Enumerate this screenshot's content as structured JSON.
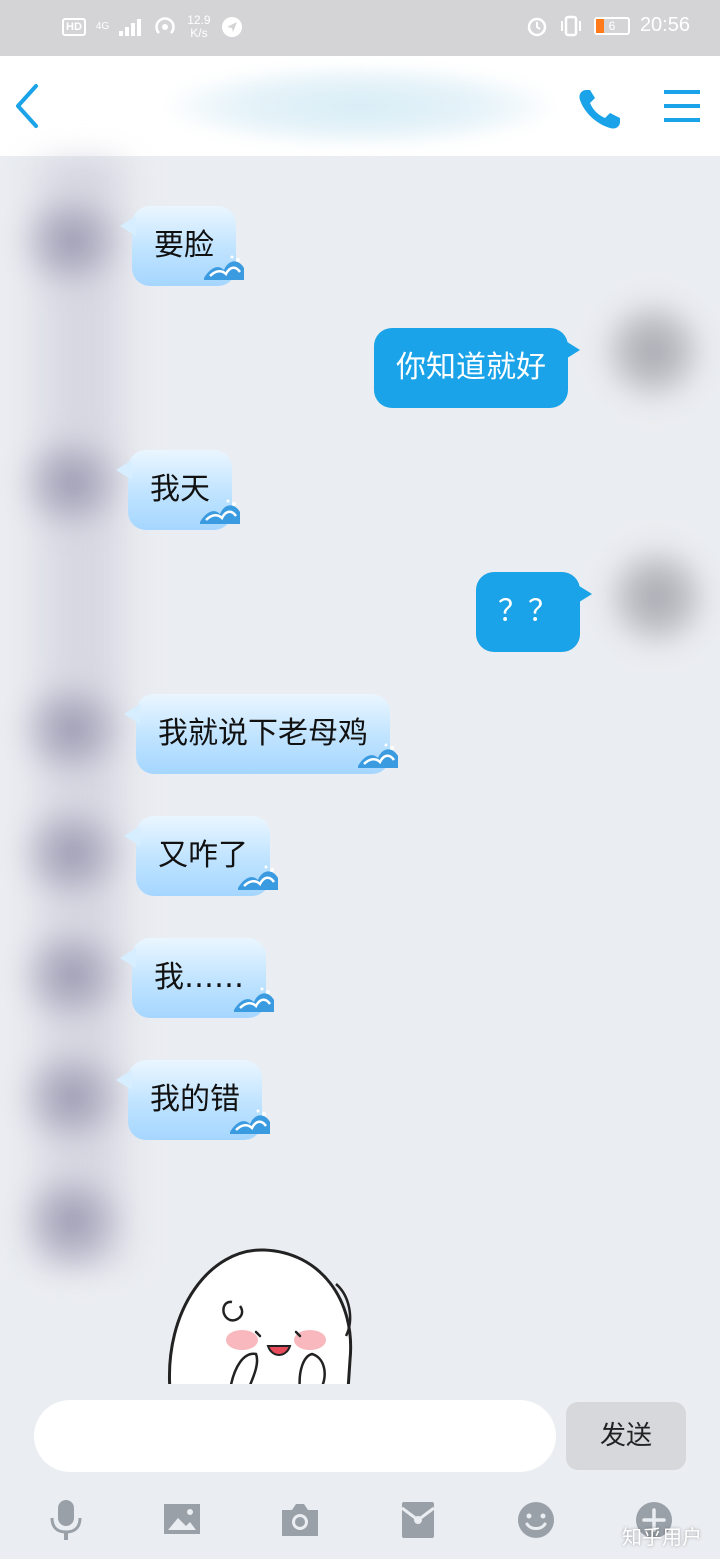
{
  "status_bar": {
    "hd": "HD",
    "network": "4G",
    "speed_value": "12.9",
    "speed_unit": "K/s",
    "battery": "6",
    "time": "20:56"
  },
  "header": {
    "back_icon": "chevron-left-icon",
    "call_icon": "phone-icon",
    "menu_icon": "hamburger-menu-icon",
    "accent_color": "#1aa3e8"
  },
  "messages": [
    {
      "side": "left",
      "text": "要脸"
    },
    {
      "side": "right",
      "text": "你知道就好"
    },
    {
      "side": "left",
      "text": "我天"
    },
    {
      "side": "right",
      "text": "？？"
    },
    {
      "side": "left",
      "text": "我就说下老母鸡"
    },
    {
      "side": "left",
      "text": "又咋了"
    },
    {
      "side": "left",
      "text": "我……"
    },
    {
      "side": "left",
      "text": "我的错"
    }
  ],
  "composer": {
    "input_value": "",
    "send_label": "发送"
  },
  "toolbar": {
    "icons": [
      "microphone-icon",
      "image-icon",
      "camera-icon",
      "red-packet-icon",
      "emoji-icon",
      "plus-icon"
    ]
  },
  "watermark": "知乎用户"
}
